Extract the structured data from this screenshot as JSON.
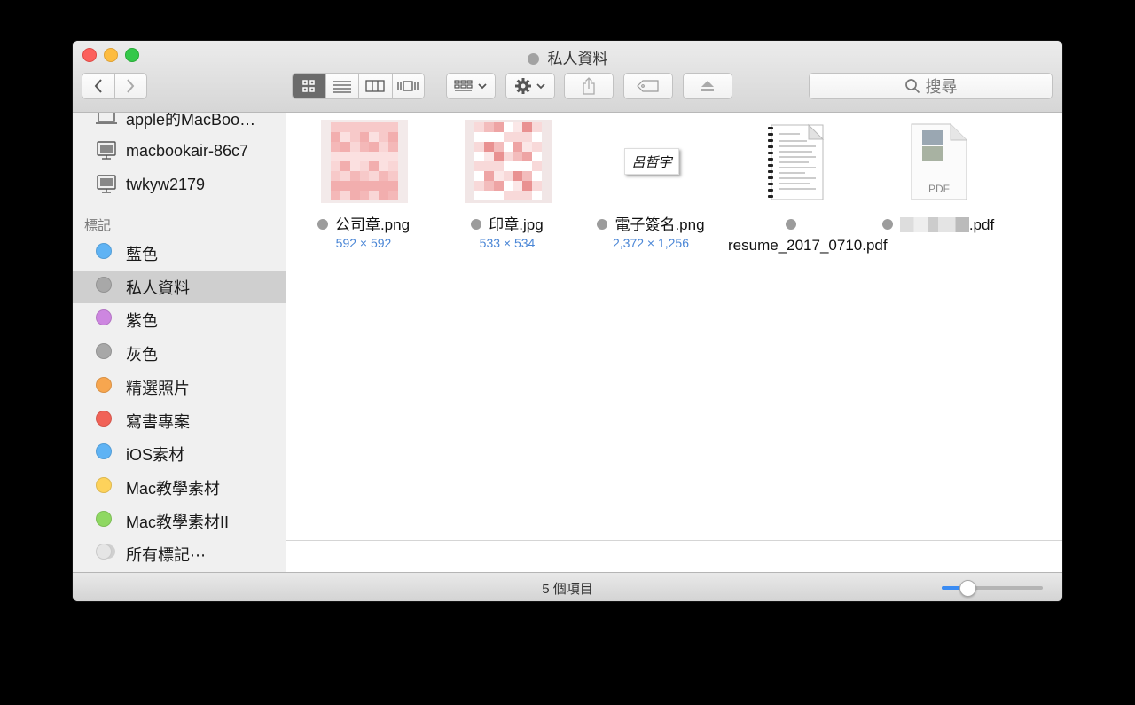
{
  "window": {
    "title": "私人資料"
  },
  "toolbar": {
    "back_icon": "chevron-left-icon",
    "forward_icon": "chevron-right-icon",
    "views": [
      "icon-view",
      "list-view",
      "column-view",
      "cover-flow-view"
    ],
    "active_view": "icon-view",
    "search_placeholder": "搜尋"
  },
  "sidebar": {
    "devices": [
      {
        "label": "apple的MacBoo…",
        "icon": "laptop-icon"
      },
      {
        "label": "macbookair-86c7",
        "icon": "computer-icon"
      },
      {
        "label": "twkyw2179",
        "icon": "computer-icon"
      }
    ],
    "tags_header": "標記",
    "tags": [
      {
        "label": "藍色",
        "color": "#5fb3f4"
      },
      {
        "label": "私人資料",
        "color": "#a8a8a8",
        "selected": true
      },
      {
        "label": "紫色",
        "color": "#cd86e0"
      },
      {
        "label": "灰色",
        "color": "#a8a8a8"
      },
      {
        "label": "精選照片",
        "color": "#f7a64f"
      },
      {
        "label": "寫書專案",
        "color": "#f16257"
      },
      {
        "label": "iOS素材",
        "color": "#5fb3f4"
      },
      {
        "label": "Mac教學素材",
        "color": "#fdd25b"
      },
      {
        "label": "Mac教學素材II",
        "color": "#8fd862"
      },
      {
        "label": "所有標記⋯",
        "color": "#e5e5e5"
      }
    ]
  },
  "files": [
    {
      "name": "公司章.png",
      "dims": "592 × 592",
      "thumb": "pixelated-image"
    },
    {
      "name": "印章.jpg",
      "dims": "533 × 534",
      "thumb": "pixelated-image"
    },
    {
      "name": "電子簽名.png",
      "dims": "2,372 × 1,256",
      "thumb": "signature-image"
    },
    {
      "name": "resume_2017_0710.pdf",
      "dims": "",
      "thumb": "document-pages"
    },
    {
      "name": ".pdf",
      "dims": "",
      "thumb": "pdf-file",
      "pdf_label": "PDF"
    }
  ],
  "signature_text": "呂哲宇",
  "status": {
    "count": "5 個項目",
    "zoom_fraction": 0.25
  }
}
